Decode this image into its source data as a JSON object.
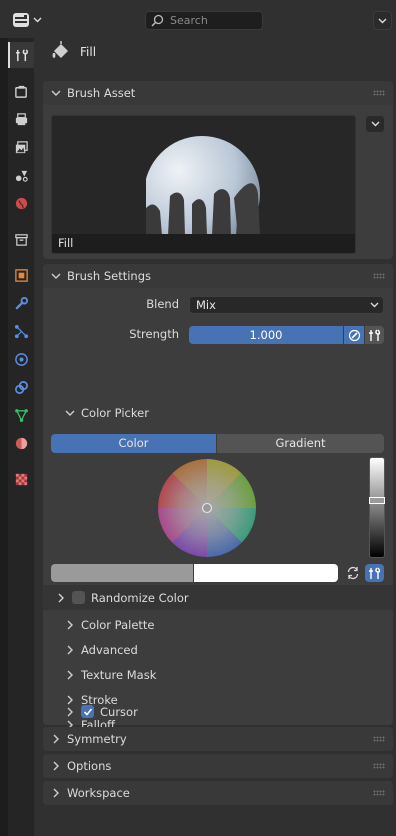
{
  "header": {
    "search_placeholder": "Search"
  },
  "tabs": [
    {
      "name": "tool",
      "active": true
    },
    {
      "name": "render"
    },
    {
      "name": "output"
    },
    {
      "name": "view-layer"
    },
    {
      "name": "scene"
    },
    {
      "name": "world"
    },
    {
      "name": "collection"
    },
    {
      "name": "object"
    },
    {
      "name": "modifiers"
    },
    {
      "name": "particles"
    },
    {
      "name": "physics"
    },
    {
      "name": "constraints"
    },
    {
      "name": "data"
    },
    {
      "name": "material"
    },
    {
      "name": "texture"
    }
  ],
  "tool": {
    "title": "Fill"
  },
  "brush_asset": {
    "header": "Brush Asset",
    "name": "Fill"
  },
  "brush_settings": {
    "header": "Brush Settings",
    "blend_label": "Blend",
    "blend_value": "Mix",
    "strength_label": "Strength",
    "strength_value": "1.000",
    "strength_fraction": 1.0
  },
  "color_picker": {
    "header": "Color Picker",
    "tab_color": "Color",
    "tab_gradient": "Gradient",
    "active_tab": "Color",
    "primary_color": "#9a9a9a",
    "secondary_color": "#ffffff"
  },
  "subsections": {
    "randomize_color": "Randomize Color",
    "color_palette": "Color Palette",
    "advanced": "Advanced",
    "texture_mask": "Texture Mask",
    "stroke": "Stroke",
    "falloff": "Falloff",
    "cursor": "Cursor",
    "randomize_checked": false,
    "cursor_checked": true
  },
  "panels": {
    "symmetry": "Symmetry",
    "options": "Options",
    "workspace": "Workspace"
  },
  "colors": {
    "accent": "#4772b3",
    "panel_bg": "#3d3d3d",
    "background": "#303030"
  }
}
